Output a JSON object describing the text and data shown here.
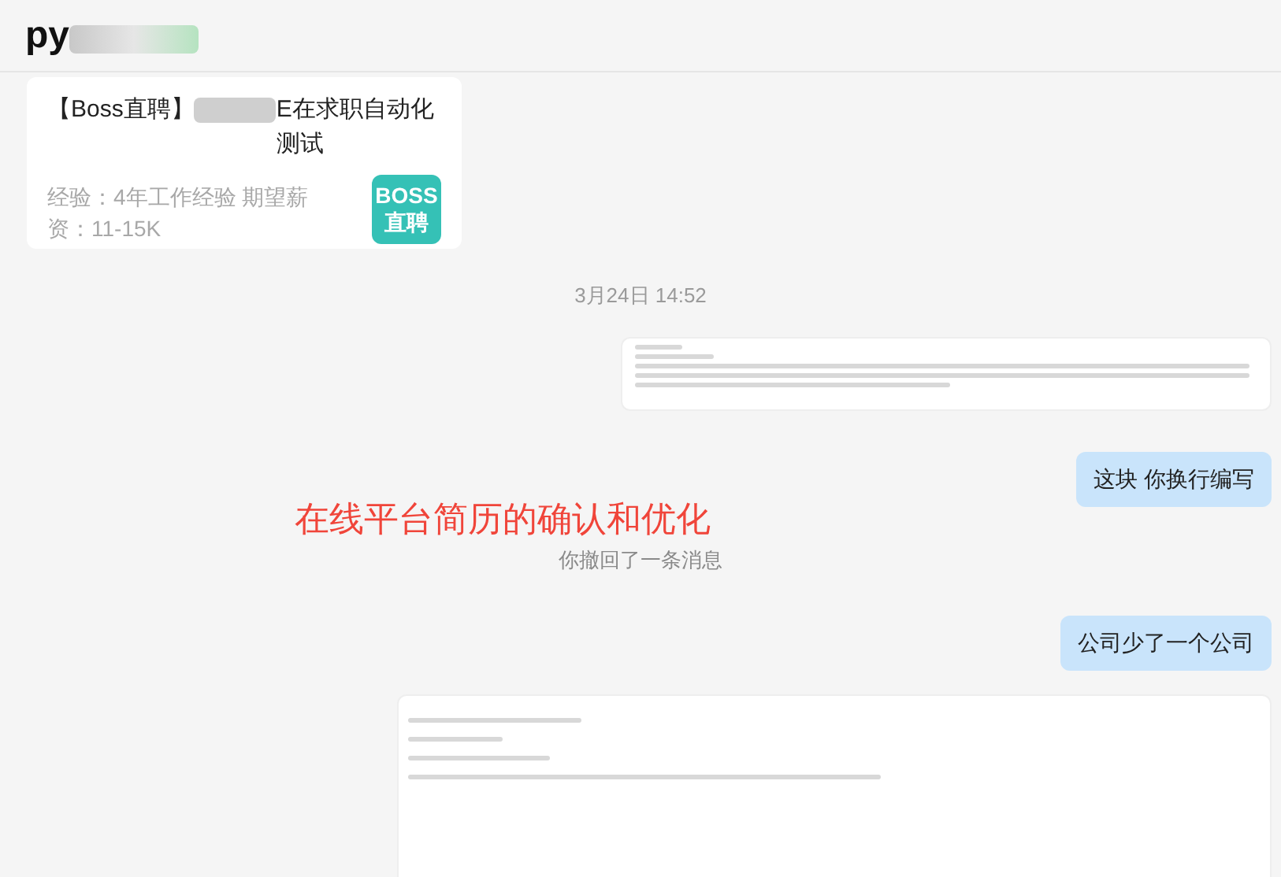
{
  "header": {
    "title_prefix": "py"
  },
  "messages": [
    {
      "kind": "card",
      "title_start": "【Boss直聘】",
      "title_end": "E在求职自动化测试",
      "details": "经验：4年工作经验   期望薪资：11-15K",
      "badge": "BOSS直聘"
    },
    {
      "kind": "time",
      "text": "3月24日 14:52"
    },
    {
      "kind": "snippet"
    },
    {
      "kind": "text",
      "text": "这块 你换行编写"
    },
    {
      "kind": "annotation",
      "text": "在线平台简历的确认和优化"
    },
    {
      "kind": "notice",
      "text": "你撤回了一条消息"
    },
    {
      "kind": "text",
      "text": "公司少了一个公司"
    },
    {
      "kind": "screenshot"
    }
  ]
}
